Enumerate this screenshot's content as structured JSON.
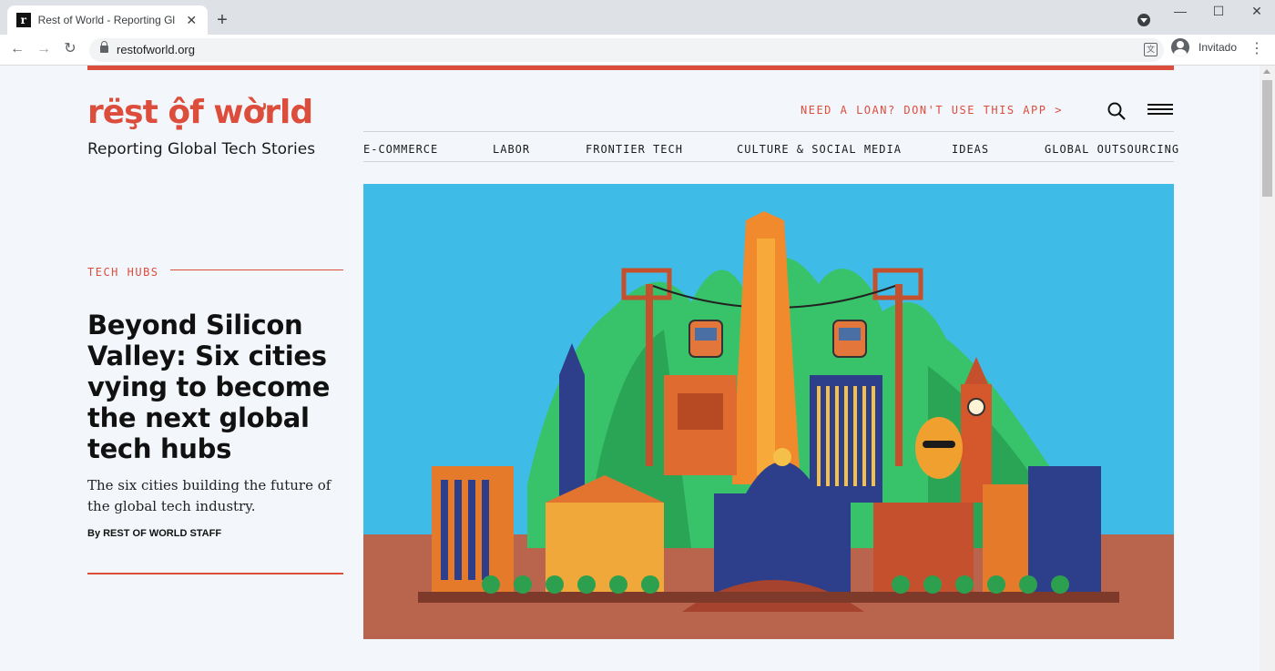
{
  "browser": {
    "tab_title": "Rest of World - Reporting Global Tech Stories",
    "tab_favicon": "r",
    "tab_close": "✕",
    "new_tab": "+",
    "url": "restofworld.org",
    "profile_label": "Invitado",
    "back": "←",
    "forward": "→",
    "reload": "↻",
    "menu": "⋮",
    "minimize": "—",
    "maximize": "☐",
    "close": "✕",
    "translate": "文"
  },
  "site": {
    "logo": "rëşt ộf wờrld",
    "tagline": "Reporting Global Tech Stories",
    "promo": "NEED A LOAN? DON'T USE THIS APP >",
    "nav": [
      "E-COMMERCE",
      "LABOR",
      "FRONTIER TECH",
      "CULTURE & SOCIAL MEDIA",
      "IDEAS",
      "GLOBAL OUTSOURCING"
    ],
    "accent_color": "#dc4d3c"
  },
  "story": {
    "kicker": "TECH HUBS",
    "headline": "Beyond Silicon Valley: Six cities vying to become the next global tech hubs",
    "dek": "The six cities building the future of the global tech industry.",
    "byline": "By REST OF WORLD STAFF"
  }
}
